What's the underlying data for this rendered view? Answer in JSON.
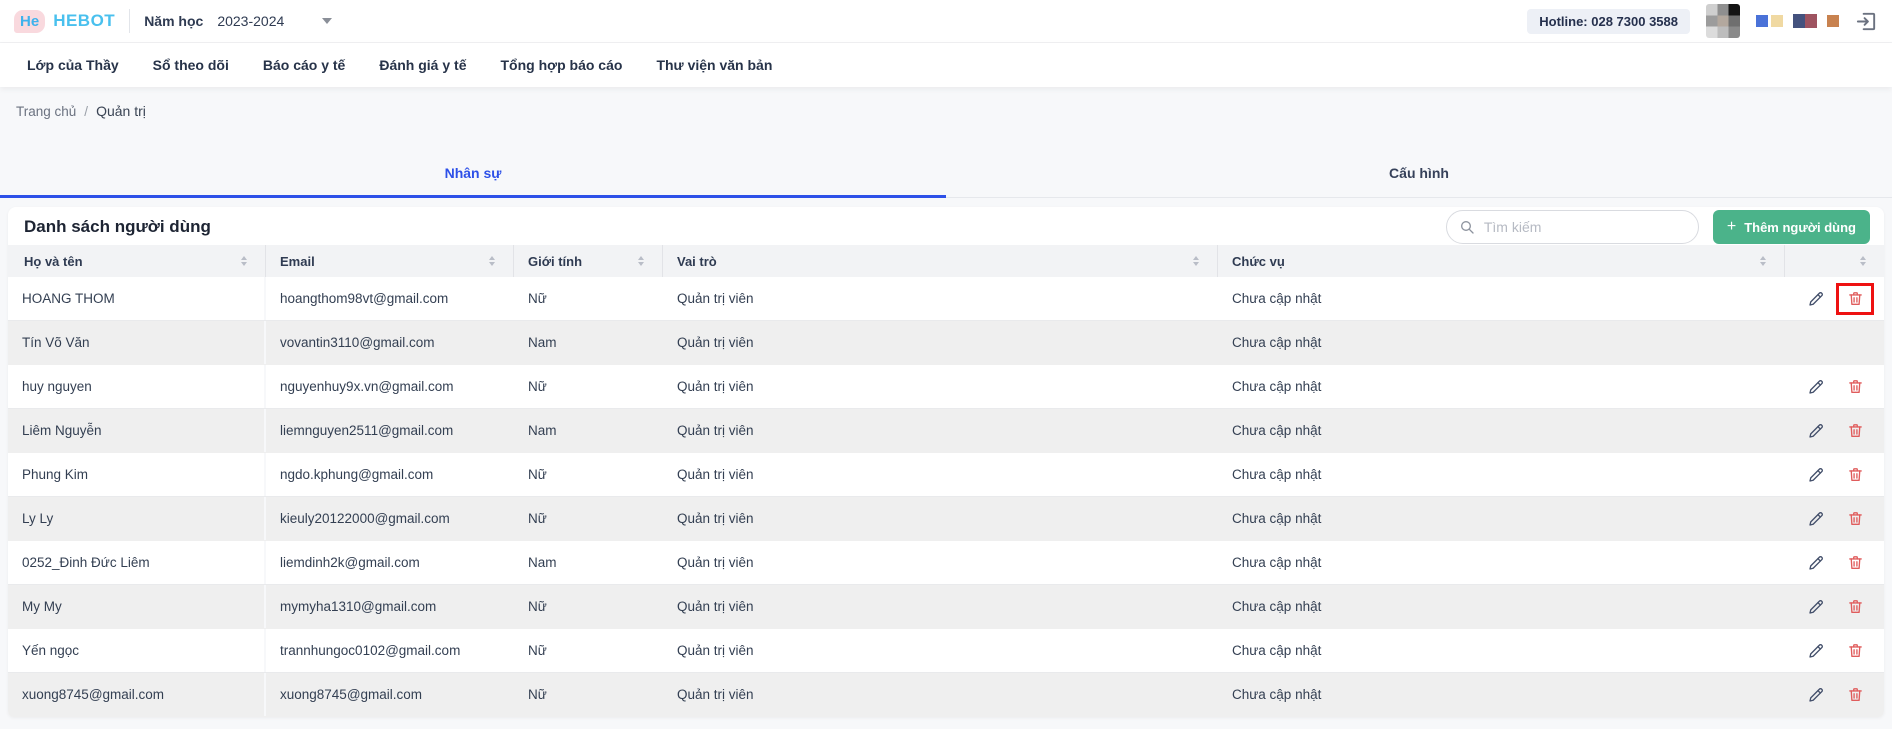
{
  "header": {
    "logo_he": "He",
    "logo_text": "HEBOT",
    "school_year_label": "Năm học",
    "school_year_value": "2023-2024",
    "hotline": "Hotline: 028 7300 3588"
  },
  "nav": {
    "items": [
      {
        "label": "Lớp của Thầy"
      },
      {
        "label": "Sổ theo dõi"
      },
      {
        "label": "Báo cáo y tế"
      },
      {
        "label": "Đánh giá y tế"
      },
      {
        "label": "Tổng hợp báo cáo"
      },
      {
        "label": "Thư viện văn bản"
      }
    ]
  },
  "breadcrumb": {
    "home": "Trang chủ",
    "separator": "/",
    "current": "Quản trị"
  },
  "tabs": [
    {
      "label": "Nhân sự",
      "active": true
    },
    {
      "label": "Cấu hình",
      "active": false
    }
  ],
  "content": {
    "title": "Danh sách người dùng",
    "search_placeholder": "Tìm kiếm",
    "add_button_plus": "+",
    "add_button": "Thêm người dùng",
    "table": {
      "columns": [
        "Họ và tên",
        "Email",
        "Giới tính",
        "Vai trò",
        "Chức vụ"
      ],
      "rows": [
        {
          "name": "HOANG THOM",
          "email": "hoangthom98vt@gmail.com",
          "gender": "Nữ",
          "role": "Quản trị viên",
          "position": "Chưa cập nhật",
          "actions": true,
          "highlight_delete": true
        },
        {
          "name": "Tín Võ Văn",
          "email": "vovantin3110@gmail.com",
          "gender": "Nam",
          "role": "Quản trị viên",
          "position": "Chưa cập nhật",
          "actions": false,
          "highlight_delete": false
        },
        {
          "name": "huy nguyen",
          "email": "nguyenhuy9x.vn@gmail.com",
          "gender": "Nữ",
          "role": "Quản trị viên",
          "position": "Chưa cập nhật",
          "actions": true,
          "highlight_delete": false
        },
        {
          "name": "Liêm Nguyễn",
          "email": "liemnguyen2511@gmail.com",
          "gender": "Nam",
          "role": "Quản trị viên",
          "position": "Chưa cập nhật",
          "actions": true,
          "highlight_delete": false
        },
        {
          "name": "Phung Kim",
          "email": "ngdo.kphung@gmail.com",
          "gender": "Nữ",
          "role": "Quản trị viên",
          "position": "Chưa cập nhật",
          "actions": true,
          "highlight_delete": false
        },
        {
          "name": "Ly Ly",
          "email": "kieuly20122000@gmail.com",
          "gender": "Nữ",
          "role": "Quản trị viên",
          "position": "Chưa cập nhật",
          "actions": true,
          "highlight_delete": false
        },
        {
          "name": "0252_Đinh Đức Liêm",
          "email": "liemdinh2k@gmail.com",
          "gender": "Nam",
          "role": "Quản trị viên",
          "position": "Chưa cập nhật",
          "actions": true,
          "highlight_delete": false
        },
        {
          "name": "My My",
          "email": "mymyha1310@gmail.com",
          "gender": "Nữ",
          "role": "Quản trị viên",
          "position": "Chưa cập nhật",
          "actions": true,
          "highlight_delete": false
        },
        {
          "name": "Yến ngọc",
          "email": "trannhungoc0102@gmail.com",
          "gender": "Nữ",
          "role": "Quản trị viên",
          "position": "Chưa cập nhật",
          "actions": true,
          "highlight_delete": false
        },
        {
          "name": "xuong8745@gmail.com",
          "email": "xuong8745@gmail.com",
          "gender": "Nữ",
          "role": "Quản trị viên",
          "position": "Chưa cập nhật",
          "actions": true,
          "highlight_delete": false
        }
      ]
    }
  },
  "icons": {
    "search": "search-icon",
    "plus": "plus-icon",
    "edit": "pencil-icon",
    "delete": "trash-icon",
    "logout": "logout-icon",
    "sort": "sorter-icon",
    "caret": "caret-down-icon"
  },
  "colors": {
    "accent": "#2d50e8",
    "green": "#4bb38a",
    "red-icon": "#e05c5c",
    "red-box": "#ee1111",
    "navy": "#2f3b52",
    "page-bg": "#f7f8fa",
    "row-alt": "#efefef",
    "header-row-bg": "#f2f3f5",
    "hotline-bg": "#edf0f6",
    "logo-blue": "#3fb2ec",
    "logo-pink": "#f9d9de"
  }
}
